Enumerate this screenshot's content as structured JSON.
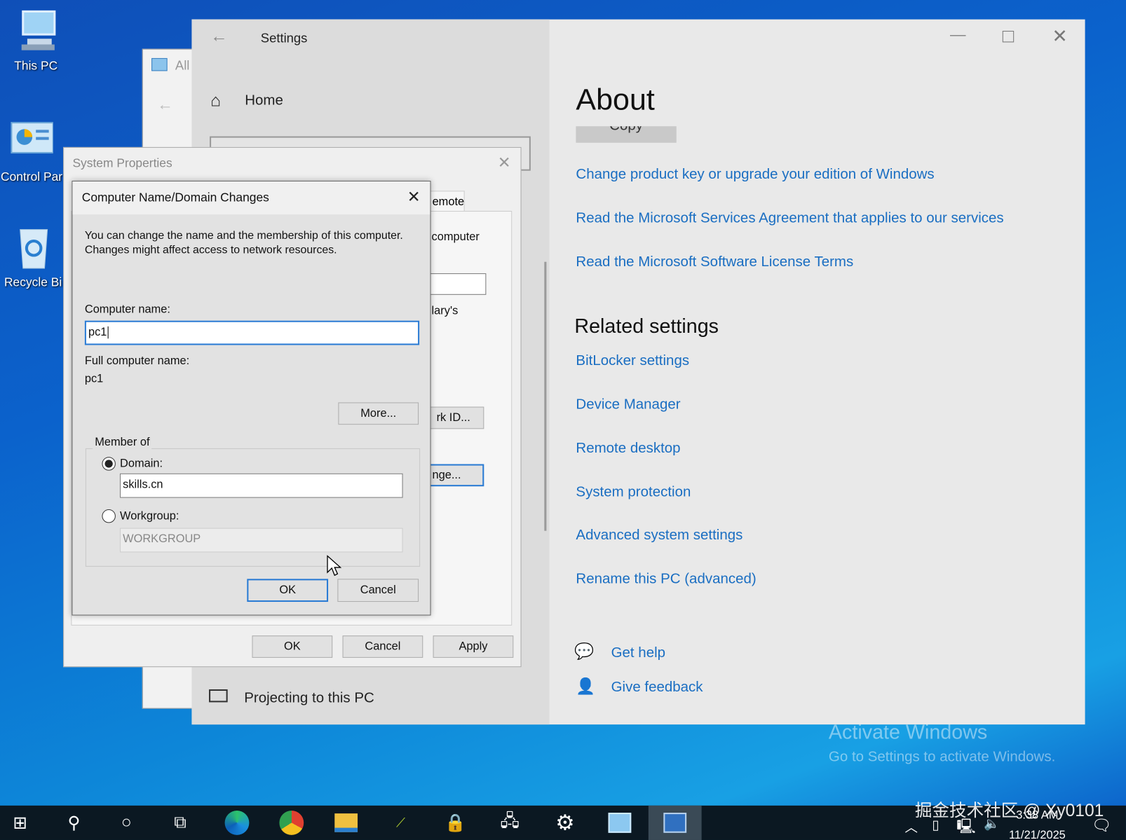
{
  "desktop": {
    "icons": [
      {
        "label": "This PC",
        "icon": "computer-icon"
      },
      {
        "label": "Control Par",
        "icon": "control-panel-icon"
      },
      {
        "label": "Recycle Bi",
        "icon": "recycle-bin-icon"
      }
    ],
    "activation": {
      "title": "Activate Windows",
      "subtitle": "Go to Settings to activate Windows."
    },
    "watermark": "掘金技术社区 @ Xy0101"
  },
  "control_panel": {
    "title": "All"
  },
  "settings": {
    "title": "Settings",
    "home": "Home",
    "projecting": "Projecting to this PC",
    "about": {
      "title": "About",
      "copy_button": "Copy",
      "links": [
        "Change product key or upgrade your edition of Windows",
        "Read the Microsoft Services Agreement that applies to our services",
        "Read the Microsoft Software License Terms"
      ]
    },
    "related": {
      "title": "Related settings",
      "links": [
        "BitLocker settings",
        "Device Manager",
        "Remote desktop",
        "System protection",
        "Advanced system settings",
        "Rename this PC (advanced)"
      ]
    },
    "help": {
      "get_help": "Get help",
      "give_feedback": "Give feedback"
    },
    "link_color": "#1a6ec2"
  },
  "system_properties": {
    "title": "System Properties",
    "tab_remote": "emote",
    "text_computer": "computer",
    "text_lary": "lary's",
    "network_id_button": "rk ID...",
    "change_button": "nge...",
    "ok": "OK",
    "cancel": "Cancel",
    "apply": "Apply"
  },
  "dialog": {
    "title": "Computer Name/Domain Changes",
    "description": "You can change the name and the membership of this computer. Changes might affect access to network resources.",
    "computer_name_label": "Computer name:",
    "computer_name_value": "pc1",
    "full_name_label": "Full computer name:",
    "full_name_value": "pc1",
    "more_button": "More...",
    "member_of": "Member of",
    "domain_label": "Domain:",
    "domain_value": "skills.cn",
    "domain_selected": true,
    "workgroup_label": "Workgroup:",
    "workgroup_value": "WORKGROUP",
    "ok": "OK",
    "cancel": "Cancel"
  },
  "taskbar": {
    "icons": [
      "windows-start-icon",
      "search-icon",
      "cortana-icon",
      "task-view-icon",
      "edge-icon",
      "chrome-icon",
      "file-explorer-icon",
      "network-tool-icon",
      "security-tool-icon",
      "remote-connection-icon",
      "settings-gear-icon",
      "control-panel-icon",
      "system-icon"
    ],
    "active_index": 12,
    "time": "3:38 AM",
    "date": "11/21/2025"
  }
}
